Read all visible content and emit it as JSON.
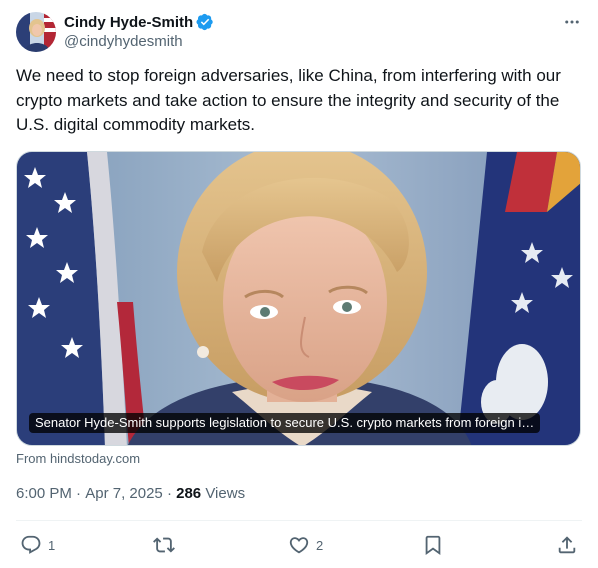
{
  "author": {
    "name": "Cindy Hyde-Smith",
    "handle": "@cindyhydesmith",
    "verified": true
  },
  "tweet": {
    "text": "We need to stop foreign adversaries, like China, from interfering with our crypto markets and take action to ensure the integrity and security of the U.S. digital commodity markets."
  },
  "card": {
    "caption": "Senator Hyde-Smith supports legislation to secure U.S. crypto markets from foreign i…",
    "source": "From hindstoday.com"
  },
  "meta": {
    "time": "6:00 PM",
    "separator": " · ",
    "date": "Apr 7, 2025",
    "views_count": "286",
    "views_label": "Views"
  },
  "actions": {
    "reply_count": "1",
    "retweet_count": "",
    "like_count": "2"
  },
  "icons": {
    "verified": "verified-badge-icon",
    "more": "more-icon",
    "reply": "reply-icon",
    "retweet": "retweet-icon",
    "like": "like-icon",
    "bookmark": "bookmark-icon",
    "share": "share-icon"
  },
  "colors": {
    "verified_blue": "#1d9bf0",
    "text_primary": "#0f1419",
    "text_secondary": "#536471",
    "divider": "#eff3f4"
  }
}
